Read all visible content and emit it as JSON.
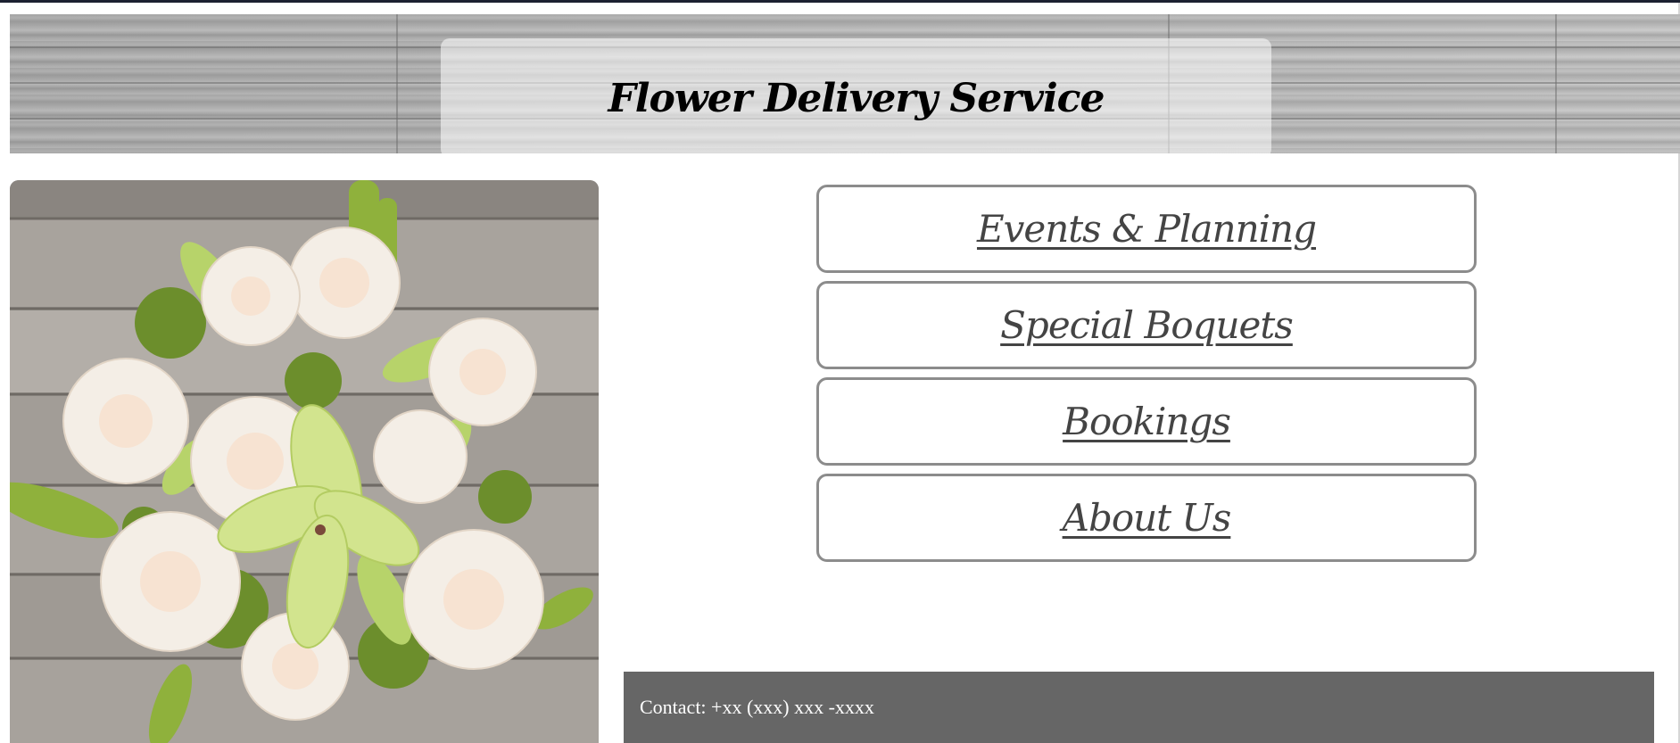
{
  "header": {
    "title": "Flower Delivery Service"
  },
  "hero": {
    "image_icon": "flower-bouquet-image"
  },
  "nav": {
    "items": [
      {
        "label": "Events & Planning"
      },
      {
        "label": "Special Boquets"
      },
      {
        "label": "Bookings"
      },
      {
        "label": "About Us"
      }
    ]
  },
  "footer": {
    "contact": "Contact: +xx (xxx) xxx -xxxx"
  },
  "colors": {
    "footer_bg": "#666666",
    "button_border": "#8c8c8c",
    "button_text": "#444444",
    "top_strip": "#1c2131"
  }
}
